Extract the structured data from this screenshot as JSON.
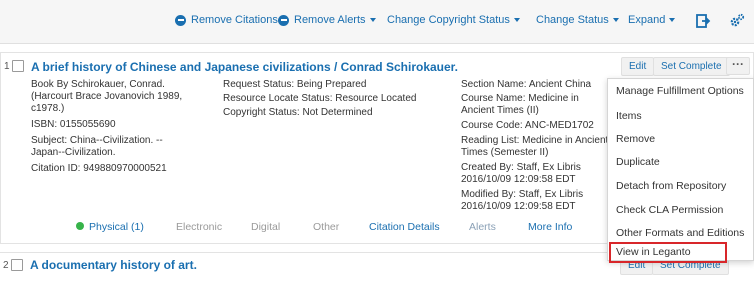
{
  "toolbar": {
    "remove_citations": "Remove Citations",
    "remove_alerts": "Remove Alerts",
    "change_copyright_status": "Change Copyright Status",
    "change_status": "Change Status",
    "expand": "Expand",
    "export_icon": "export-icon",
    "settings_icon": "gears-icon"
  },
  "citations": [
    {
      "number": "1",
      "title": "A brief history of Chinese and Japanese civilizations / Conrad Schirokauer.",
      "book_line": "Book By Schirokauer, Conrad.",
      "book_line2": "(Harcourt Brace Jovanovich 1989,",
      "book_line3": "c1978.)",
      "isbn": "ISBN: 0155055690",
      "subject_line1": "Subject: China--Civilization. --",
      "subject_line2": "Japan--Civilization.",
      "citation_id": "Citation ID: 949880970000521",
      "request_status": "Request Status: Being Prepared",
      "resource_locate_status": "Resource Locate Status: Resource Located",
      "copyright_status": "Copyright Status: Not Determined",
      "section_name": "Section Name: Ancient China",
      "course_name_1": "Course Name: Medicine in",
      "course_name_2": "Ancient Times (II)",
      "course_code": "Course Code: ANC-MED1702",
      "reading_list_1": "Reading List: Medicine in Ancient",
      "reading_list_2": "Times (Semester II)",
      "created_by_1": "Created By: Staff, Ex Libris",
      "created_by_2": "2016/10/09 12:09:58 EDT",
      "modified_by_1": "Modified By: Staff, Ex Libris",
      "modified_by_2": "2016/10/09 12:09:58 EDT",
      "edit_label": "Edit",
      "set_complete_label": "Set Complete",
      "more_label": "···",
      "tabs": {
        "physical": "Physical (1)",
        "electronic": "Electronic",
        "digital": "Digital",
        "other": "Other",
        "citation_details": "Citation Details",
        "alerts": "Alerts",
        "more_info": "More Info"
      }
    },
    {
      "number": "2",
      "title": "A documentary history of art.",
      "edit_label": "Edit",
      "set_complete_label": "Set Complete"
    }
  ],
  "menu": {
    "items": [
      "Manage Fulfillment Options",
      "Items",
      "Remove",
      "Duplicate",
      "Detach from Repository",
      "Check CLA Permission",
      "Other Formats and Editions",
      "View in Leganto"
    ]
  },
  "colors": {
    "link": "#1a6fb0",
    "status_dot": "#37b34a",
    "highlight": "#d8262a"
  }
}
